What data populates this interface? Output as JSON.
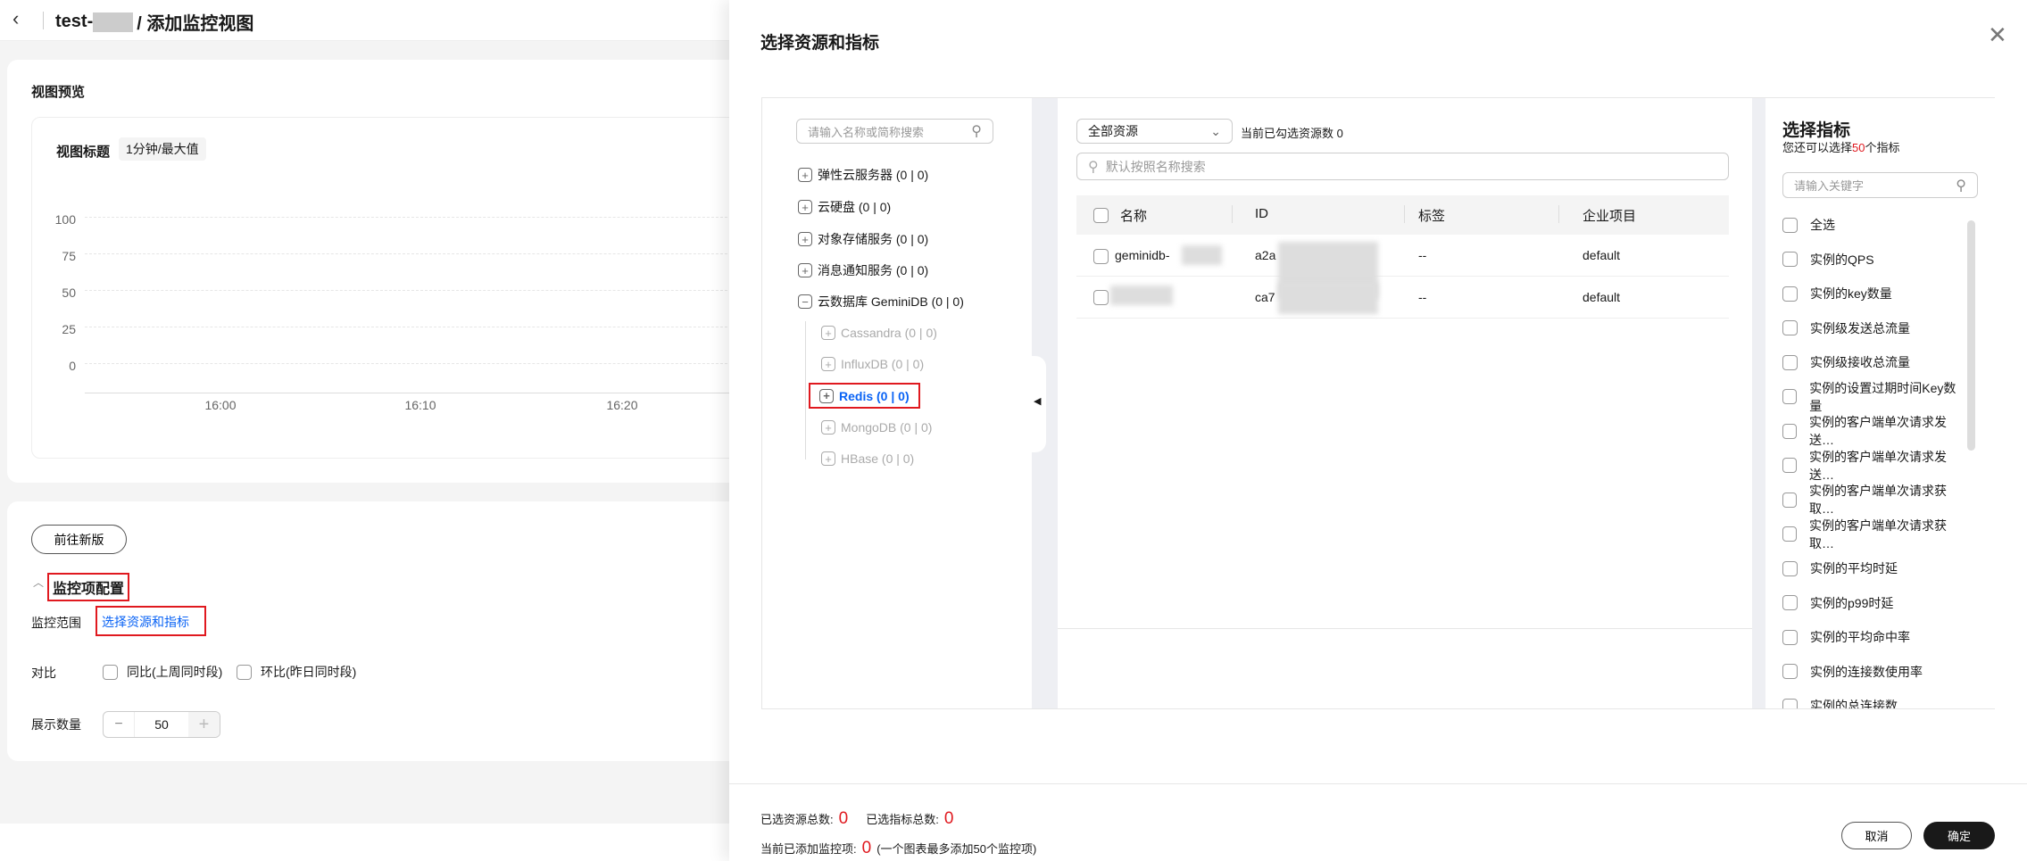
{
  "header": {
    "title_prefix": "test-",
    "title_suffix": "/ 添加监控视图"
  },
  "preview": {
    "section_title": "视图预览",
    "chart_title": "视图标题",
    "period_tag": "1分钟/最大值"
  },
  "chart_data": {
    "type": "line",
    "title": "视图标题",
    "series": [],
    "y_ticks": [
      "100",
      "75",
      "50",
      "25",
      "0"
    ],
    "ylim": [
      0,
      100
    ],
    "x_ticks": [
      "16:00",
      "16:10",
      "16:20"
    ],
    "grid": true
  },
  "config": {
    "new_version_button": "前往新版",
    "section_title": "监控项配置",
    "scope_label": "监控范围",
    "scope_link": "选择资源和指标",
    "compare_label": "对比",
    "compare_yoy": "同比(上周同时段)",
    "compare_mom": "环比(昨日同时段)",
    "count_label": "展示数量",
    "count_value": "50",
    "minus": "−",
    "plus": "+"
  },
  "drawer": {
    "title": "选择资源和指标",
    "tree": {
      "search_placeholder": "请输入名称或简称搜索",
      "items": [
        {
          "label": "弹性云服务器 (0 | 0)"
        },
        {
          "label": "云硬盘 (0 | 0)"
        },
        {
          "label": "对象存储服务 (0 | 0)"
        },
        {
          "label": "消息通知服务 (0 | 0)"
        },
        {
          "label": "云数据库 GeminiDB (0 | 0)"
        }
      ],
      "sub_items": [
        {
          "label": "Cassandra (0 | 0)"
        },
        {
          "label": "InfluxDB (0 | 0)"
        },
        {
          "label": "Redis (0 | 0)"
        },
        {
          "label": "MongoDB (0 | 0)"
        },
        {
          "label": "HBase (0 | 0)"
        }
      ]
    },
    "resources": {
      "dropdown": "全部资源",
      "selected_count_text": "当前已勾选资源数 0",
      "search_placeholder": "默认按照名称搜索",
      "columns": [
        "名称",
        "ID",
        "标签",
        "企业项目"
      ],
      "rows": [
        {
          "name": "geminidb-",
          "id": "a2a",
          "tag": "--",
          "project": "default"
        },
        {
          "name": "",
          "id": "ca7",
          "tag": "--",
          "project": "default"
        }
      ]
    },
    "metrics": {
      "title": "选择指标",
      "remaining_prefix": "您还可以选择",
      "remaining_count": "50",
      "remaining_suffix": "个指标",
      "search_placeholder": "请输入关键字",
      "items": [
        "全选",
        "实例的QPS",
        "实例的key数量",
        "实例级发送总流量",
        "实例级接收总流量",
        "实例的设置过期时间Key数量",
        "实例的客户端单次请求发送…",
        "实例的客户端单次请求发送…",
        "实例的客户端单次请求获取…",
        "实例的客户端单次请求获取…",
        "实例的平均时延",
        "实例的p99时延",
        "实例的平均命中率",
        "实例的连接数使用率",
        "实例的总连接数"
      ]
    },
    "footer": {
      "selected_resources_label": "已选资源总数:",
      "selected_resources": "0",
      "selected_metrics_label": "已选指标总数:",
      "selected_metrics": "0",
      "added_label": "当前已添加监控项:",
      "added": "0",
      "limit_note": "(一个图表最多添加50个监控项)",
      "cancel": "取消",
      "confirm": "确定"
    }
  }
}
